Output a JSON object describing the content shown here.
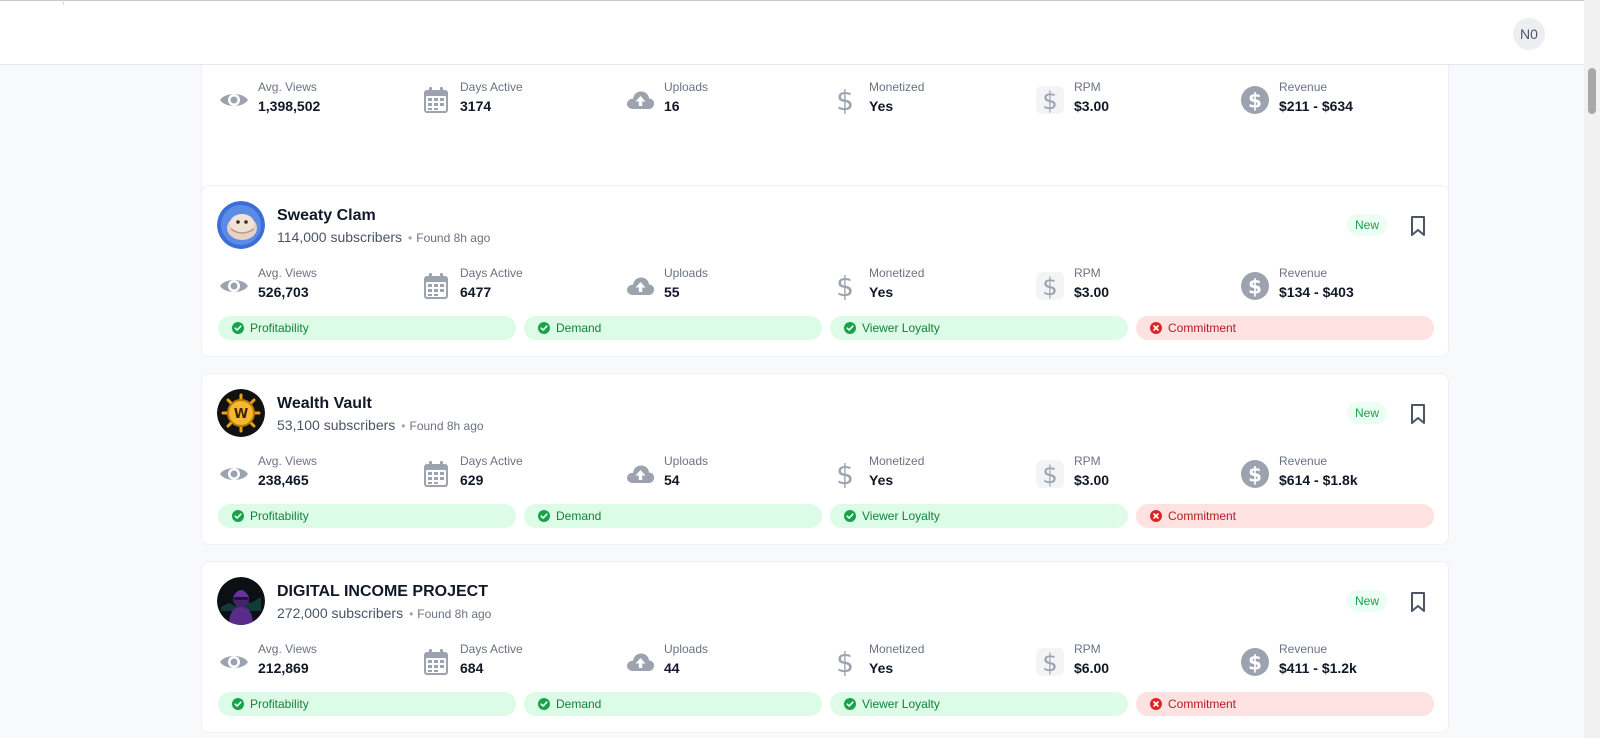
{
  "header": {
    "user_initials": "N0"
  },
  "stat_labels": {
    "avg_views": "Avg. Views",
    "days_active": "Days Active",
    "uploads": "Uploads",
    "monetized": "Monetized",
    "rpm": "RPM",
    "revenue": "Revenue"
  },
  "signal_labels": {
    "profitability": "Profitability",
    "demand": "Demand",
    "viewer_loyalty": "Viewer Loyalty",
    "commitment": "Commitment"
  },
  "colors": {
    "positive": "#15803d",
    "negative": "#b91c1c",
    "badge": "#16a34a"
  },
  "channels": [
    {
      "stats": {
        "avg_views": "1,398,502",
        "days_active": "3174",
        "uploads": "16",
        "monetized": "Yes",
        "rpm": "$3.00",
        "revenue": "$211 - $634"
      },
      "signals": {
        "profitability": "positive",
        "demand": "positive",
        "viewer_loyalty": "positive",
        "commitment": "negative"
      }
    },
    {
      "name": "Sweaty Clam",
      "subscribers": "114,000 subscribers",
      "found": "Found 8h ago",
      "badge": "New",
      "avatar_icon": "clam-avatar",
      "stats": {
        "avg_views": "526,703",
        "days_active": "6477",
        "uploads": "55",
        "monetized": "Yes",
        "rpm": "$3.00",
        "revenue": "$134 - $403"
      },
      "signals": {
        "profitability": "positive",
        "demand": "positive",
        "viewer_loyalty": "positive",
        "commitment": "negative"
      }
    },
    {
      "name": "Wealth Vault",
      "subscribers": "53,100 subscribers",
      "found": "Found 8h ago",
      "badge": "New",
      "avatar_icon": "vault-wheel-avatar",
      "avatar_letter": "W",
      "stats": {
        "avg_views": "238,465",
        "days_active": "629",
        "uploads": "54",
        "monetized": "Yes",
        "rpm": "$3.00",
        "revenue": "$614 - $1.8k"
      },
      "signals": {
        "profitability": "positive",
        "demand": "positive",
        "viewer_loyalty": "positive",
        "commitment": "negative"
      }
    },
    {
      "name": "DIGITAL INCOME PROJECT",
      "subscribers": "272,000 subscribers",
      "found": "Found 8h ago",
      "badge": "New",
      "avatar_icon": "hooded-figure-avatar",
      "stats": {
        "avg_views": "212,869",
        "days_active": "684",
        "uploads": "44",
        "monetized": "Yes",
        "rpm": "$6.00",
        "revenue": "$411 - $1.2k"
      },
      "signals": {
        "profitability": "positive",
        "demand": "positive",
        "viewer_loyalty": "positive",
        "commitment": "negative"
      }
    }
  ]
}
